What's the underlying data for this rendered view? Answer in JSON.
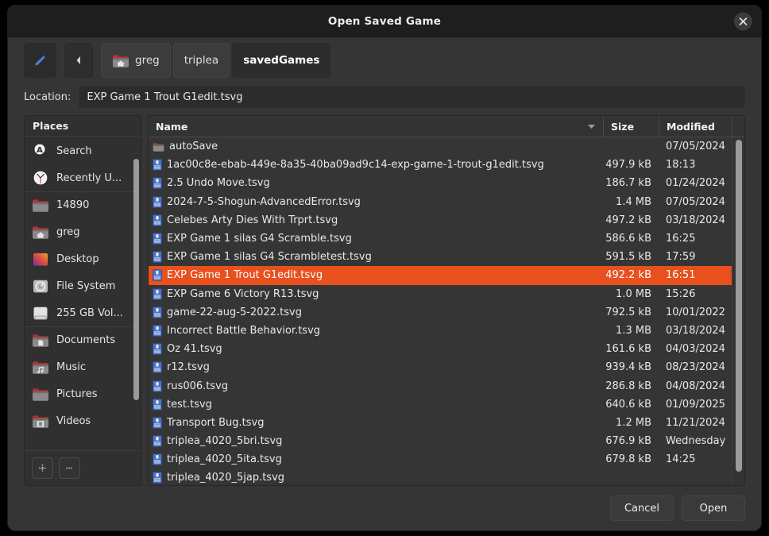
{
  "window": {
    "title": "Open Saved Game",
    "close_icon": "close-icon"
  },
  "toolbar": {
    "pencil_icon": "pencil-icon",
    "back_icon": "chevron-left-icon",
    "breadcrumbs": [
      {
        "label": "greg",
        "icon": "home-folder-icon",
        "current": false
      },
      {
        "label": "triplea",
        "icon": "",
        "current": false
      },
      {
        "label": "savedGames",
        "icon": "",
        "current": true
      }
    ]
  },
  "location": {
    "label": "Location:",
    "value": "EXP Game 1 Trout G1edit.tsvg",
    "placeholder": ""
  },
  "sidebar": {
    "header": "Places",
    "items": [
      {
        "label": "Search",
        "icon": "search-icon",
        "sep": false
      },
      {
        "label": "Recently U...",
        "icon": "clock-icon",
        "sep": false
      },
      {
        "label": "14890",
        "icon": "folder-icon",
        "sep": true
      },
      {
        "label": "greg",
        "icon": "home-folder-icon",
        "sep": false
      },
      {
        "label": "Desktop",
        "icon": "desktop-icon",
        "sep": false
      },
      {
        "label": "File System",
        "icon": "disk-icon",
        "sep": false
      },
      {
        "label": "255 GB Vol...",
        "icon": "volume-icon",
        "sep": false
      },
      {
        "label": "Documents",
        "icon": "documents-icon",
        "sep": true
      },
      {
        "label": "Music",
        "icon": "music-icon",
        "sep": false
      },
      {
        "label": "Pictures",
        "icon": "pictures-icon",
        "sep": false
      },
      {
        "label": "Videos",
        "icon": "videos-icon",
        "sep": false
      }
    ],
    "footer": {
      "add_label": "+",
      "remove_label": "–",
      "add_icon": "plus-icon",
      "remove_icon": "minus-icon"
    }
  },
  "filelist": {
    "columns": {
      "name": "Name",
      "size": "Size",
      "modified": "Modified",
      "sort_icon": "sort-descending-icon"
    },
    "rows": [
      {
        "name": "autoSave",
        "icon": "folder-icon",
        "size": "",
        "modified": "07/05/2024",
        "selected": false
      },
      {
        "name": "1ac00c8e-ebab-449e-8a35-40ba09ad9c14-exp-game-1-trout-g1edit.tsvg",
        "icon": "tsvg-file-icon",
        "size": "497.9 kB",
        "modified": "18:13",
        "selected": false
      },
      {
        "name": "2.5 Undo Move.tsvg",
        "icon": "tsvg-file-icon",
        "size": "186.7 kB",
        "modified": "01/24/2024",
        "selected": false
      },
      {
        "name": "2024-7-5-Shogun-AdvancedError.tsvg",
        "icon": "tsvg-file-icon",
        "size": "1.4 MB",
        "modified": "07/05/2024",
        "selected": false
      },
      {
        "name": "Celebes Arty Dies With Trprt.tsvg",
        "icon": "tsvg-file-icon",
        "size": "497.2 kB",
        "modified": "03/18/2024",
        "selected": false
      },
      {
        "name": "EXP Game 1 silas G4 Scramble.tsvg",
        "icon": "tsvg-file-icon",
        "size": "586.6 kB",
        "modified": "16:25",
        "selected": false
      },
      {
        "name": "EXP Game 1 silas G4 Scrambletest.tsvg",
        "icon": "tsvg-file-icon",
        "size": "591.5 kB",
        "modified": "17:59",
        "selected": false
      },
      {
        "name": "EXP Game 1 Trout G1edit.tsvg",
        "icon": "tsvg-file-icon",
        "size": "492.2 kB",
        "modified": "16:51",
        "selected": true
      },
      {
        "name": "EXP Game 6 Victory R13.tsvg",
        "icon": "tsvg-file-icon",
        "size": "1.0 MB",
        "modified": "15:26",
        "selected": false
      },
      {
        "name": "game-22-aug-5-2022.tsvg",
        "icon": "tsvg-file-icon",
        "size": "792.5 kB",
        "modified": "10/01/2022",
        "selected": false
      },
      {
        "name": "Incorrect Battle Behavior.tsvg",
        "icon": "tsvg-file-icon",
        "size": "1.3 MB",
        "modified": "03/18/2024",
        "selected": false
      },
      {
        "name": "Oz 41.tsvg",
        "icon": "tsvg-file-icon",
        "size": "161.6 kB",
        "modified": "04/03/2024",
        "selected": false
      },
      {
        "name": "r12.tsvg",
        "icon": "tsvg-file-icon",
        "size": "939.4 kB",
        "modified": "08/23/2024",
        "selected": false
      },
      {
        "name": "rus006.tsvg",
        "icon": "tsvg-file-icon",
        "size": "286.8 kB",
        "modified": "04/08/2024",
        "selected": false
      },
      {
        "name": "test.tsvg",
        "icon": "tsvg-file-icon",
        "size": "640.6 kB",
        "modified": "01/09/2025",
        "selected": false
      },
      {
        "name": "Transport Bug.tsvg",
        "icon": "tsvg-file-icon",
        "size": "1.2 MB",
        "modified": "11/21/2024",
        "selected": false
      },
      {
        "name": "triplea_4020_5bri.tsvg",
        "icon": "tsvg-file-icon",
        "size": "676.9 kB",
        "modified": "Wednesday",
        "selected": false
      },
      {
        "name": "triplea_4020_5ita.tsvg",
        "icon": "tsvg-file-icon",
        "size": "679.8 kB",
        "modified": "14:25",
        "selected": false
      },
      {
        "name": "triplea_4020_5jap.tsvg",
        "icon": "tsvg-file-icon",
        "size": "",
        "modified": "",
        "selected": false
      }
    ]
  },
  "footer": {
    "cancel_label": "Cancel",
    "open_label": "Open"
  },
  "colors": {
    "selection": "#e8501e",
    "dialog_bg": "#353535",
    "titlebar_bg": "#1e1e1e",
    "text": "#e8e8e8"
  }
}
